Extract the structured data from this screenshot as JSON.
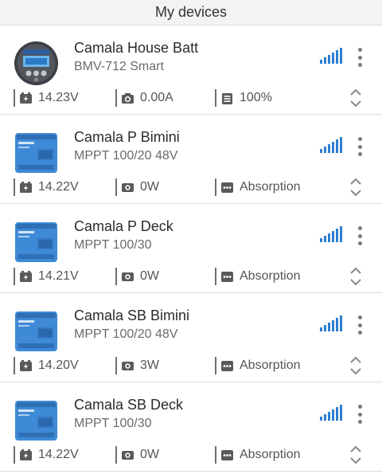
{
  "header": {
    "title": "My devices"
  },
  "colors": {
    "signal": "#2d7fd1",
    "icon": "#5a5a5a",
    "mppt_blue": "#3f8ad6"
  },
  "devices": [
    {
      "name": "Camala House Batt",
      "model": "BMV-712 Smart",
      "thumb": "bmv-monitor",
      "voltage": "14.23V",
      "second_icon": "camera-icon",
      "second": "0.00A",
      "third_icon": "notepad-icon",
      "third": "100%"
    },
    {
      "name": "Camala P Bimini",
      "model": "MPPT 100/20 48V",
      "thumb": "mppt-charger",
      "voltage": "14.22V",
      "second_icon": "solar-icon",
      "second": "0W",
      "third_icon": "dots-icon",
      "third": "Absorption"
    },
    {
      "name": "Camala P Deck",
      "model": "MPPT 100/30",
      "thumb": "mppt-charger",
      "voltage": "14.21V",
      "second_icon": "solar-icon",
      "second": "0W",
      "third_icon": "dots-icon",
      "third": "Absorption"
    },
    {
      "name": "Camala SB Bimini",
      "model": "MPPT 100/20 48V",
      "thumb": "mppt-charger",
      "voltage": "14.20V",
      "second_icon": "solar-icon",
      "second": "3W",
      "third_icon": "dots-icon",
      "third": "Absorption"
    },
    {
      "name": "Camala SB Deck",
      "model": "MPPT 100/30",
      "thumb": "mppt-charger",
      "voltage": "14.22V",
      "second_icon": "solar-icon",
      "second": "0W",
      "third_icon": "dots-icon",
      "third": "Absorption"
    }
  ]
}
